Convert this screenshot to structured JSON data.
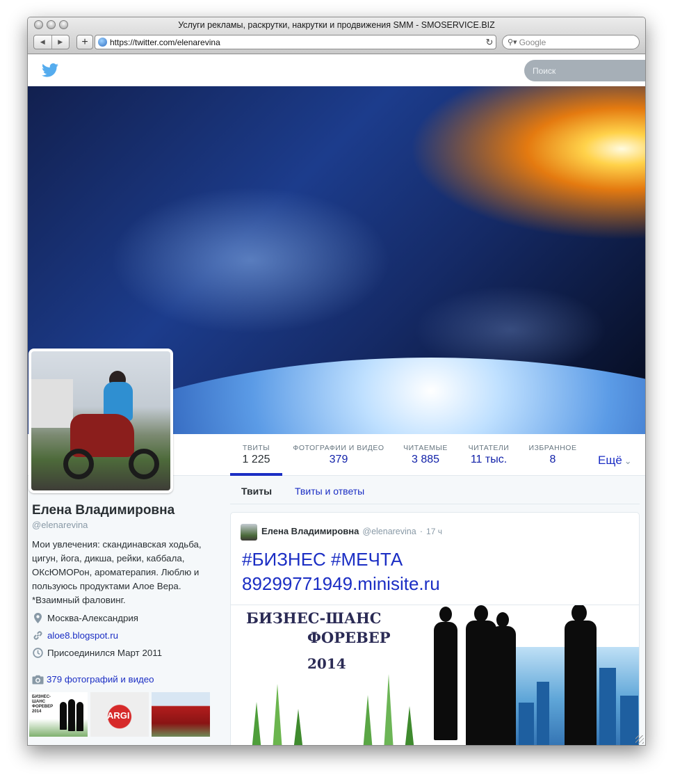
{
  "browser": {
    "window_title": "Услуги рекламы, раскрутки, накрутки и продвижения SMM - SMOSERVICE.BIZ",
    "url": "https://twitter.com/elenarevina",
    "search_placeholder": "Google",
    "back_icon": "back-arrow-icon",
    "forward_icon": "forward-arrow-icon"
  },
  "twitter": {
    "search_placeholder": "Поиск",
    "brand_color": "#55acee",
    "link_color": "#1b2ec4"
  },
  "stats": [
    {
      "label": "ТВИТЫ",
      "value": "1 225"
    },
    {
      "label": "ФОТОГРАФИИ И ВИДЕО",
      "value": "379"
    },
    {
      "label": "ЧИТАЕМЫЕ",
      "value": "3 885"
    },
    {
      "label": "ЧИТАТЕЛИ",
      "value": "11 тыс."
    },
    {
      "label": "ИЗБРАННОЕ",
      "value": "8"
    }
  ],
  "more_label": "Ещё",
  "profile": {
    "name": "Елена Владимировна",
    "handle": "@elenarevina",
    "bio_lines": [
      "Мои увлечения: скандинавская ходьба,",
      "цигун, йога, дикша, рейки, каббала,",
      "ОКсЮМОРон, ароматерапия. Люблю и",
      "пользуюсь продуктами Алое Вера.",
      "*Взаимный фаловинг."
    ],
    "location": "Москва-Александрия",
    "website": "aloe8.blogspot.ru",
    "joined": "Присоединился Март 2011",
    "photos_link": "379 фотографий и видео"
  },
  "thumbs": {
    "t1_lines": [
      "БИЗНЕС-ШАНС",
      "ФОРЕВЕР",
      "2014"
    ],
    "t2_label": "ARGI"
  },
  "tabs": [
    {
      "label": "Твиты"
    },
    {
      "label": "Твиты и ответы"
    }
  ],
  "tweet": {
    "author_name": "Елена Владимировна",
    "author_handle": "@elenarevina",
    "separator": "·",
    "time": "17 ч",
    "text_line1": "#БИЗНЕС #МЕЧТА",
    "text_line2": "89299771949.minisite.ru",
    "media": {
      "line1": "БИЗНЕС-ШАНС",
      "line2": "ФОРЕВЕР",
      "line3": "2014"
    }
  }
}
